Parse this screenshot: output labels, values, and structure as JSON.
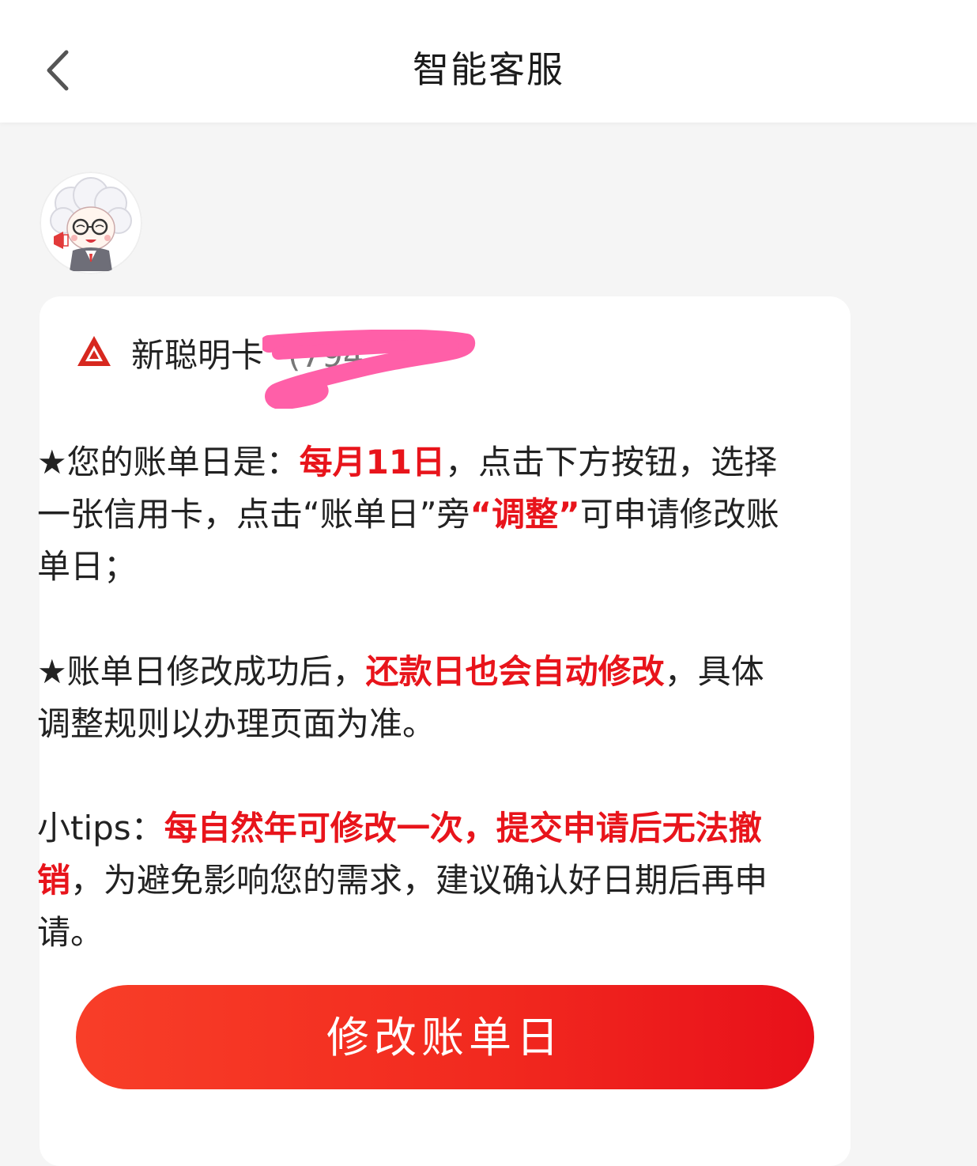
{
  "header": {
    "title": "智能客服",
    "back_icon": "chevron-left-icon"
  },
  "assistant": {
    "avatar_icon": "assistant-avatar"
  },
  "card": {
    "bank_logo_icon": "bank-logo",
    "card_name": "新聪明卡",
    "card_number": "(794",
    "paragraph1": {
      "prefix": "★您的账单日是：",
      "highlight1": "每月11日",
      "middle": "，点击下方按钮，选择一张信用卡，点击“账单日”旁",
      "highlight2": "“调整”",
      "suffix": "可申请修改账单日；"
    },
    "paragraph2": {
      "prefix": "★账单日修改成功后，",
      "highlight": "还款日也会自动修改",
      "suffix": "，具体调整规则以办理页面为准。"
    },
    "paragraph3": {
      "prefix": "小tips：",
      "highlight": "每自然年可修改一次，提交申请后无法撤销",
      "suffix": "，为避免影响您的需求，建议确认好日期后再申请。"
    },
    "action_label": "修改账单日"
  },
  "colors": {
    "accent_red": "#e8141b",
    "button_gradient_start": "#f83e28",
    "button_gradient_end": "#e8101a",
    "redaction_pink": "#ff5fa8",
    "background": "#f5f5f5"
  }
}
